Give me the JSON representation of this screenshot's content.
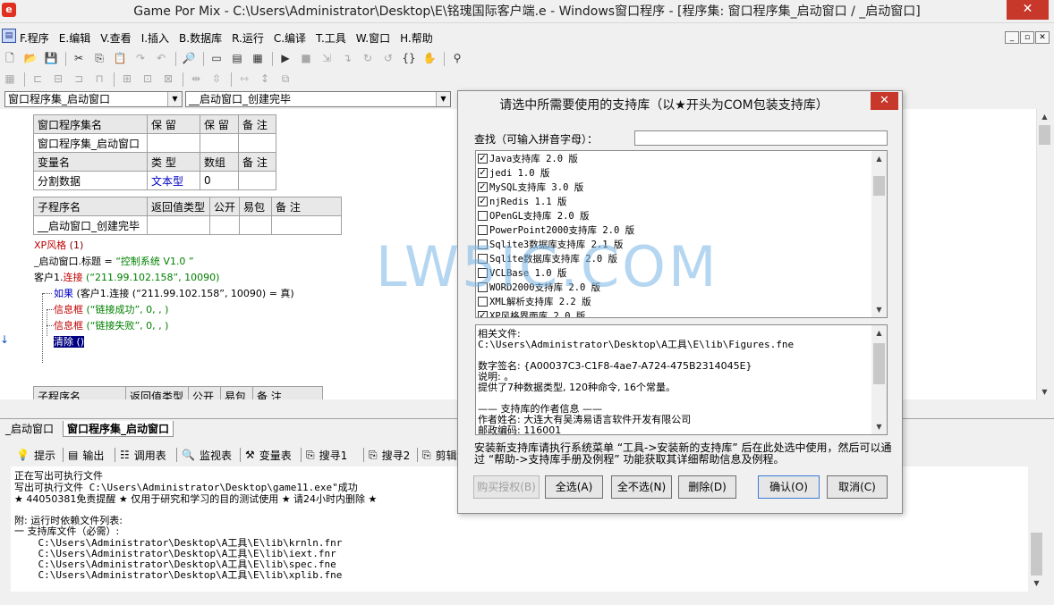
{
  "window": {
    "title": "Game Por Mix - C:\\Users\\Administrator\\Desktop\\E\\铭瑰国际客户端.e - Windows窗口程序 - [程序集: 窗口程序集_启动窗口 / _启动窗口]",
    "logo": "e",
    "close": "✕"
  },
  "menu": {
    "items": [
      "F.程序",
      "E.编辑",
      "V.查看",
      "I.插入",
      "B.数据库",
      "R.运行",
      "C.编译",
      "T.工具",
      "W.窗口",
      "H.帮助"
    ],
    "mdi": [
      "_",
      "▫",
      "✕"
    ]
  },
  "combos": {
    "left": "窗口程序集_启动窗口",
    "right": "__启动窗口_创建完毕"
  },
  "editor": {
    "table1": {
      "headers": [
        "窗口程序集名",
        "保 留",
        "保 留",
        "备 注"
      ],
      "row": [
        "窗口程序集_启动窗口",
        "",
        "",
        ""
      ],
      "var_headers": [
        "变量名",
        "类 型",
        "数组",
        "备 注"
      ],
      "var_row": [
        "分割数据",
        "文本型",
        "0",
        ""
      ]
    },
    "table2": {
      "headers": [
        "子程序名",
        "返回值类型",
        "公开",
        "易包",
        "备 注"
      ],
      "row": [
        "__启动窗口_创建完毕",
        "",
        "",
        "",
        ""
      ]
    },
    "table3": {
      "headers": [
        "子程序名",
        "返回值类型",
        "公开",
        "易包",
        "备 注"
      ]
    },
    "code": {
      "line1_fn": "XP风格",
      "line1_arg": " (1)",
      "line2_obj": "_启动窗口.",
      "line2_prop": "标题",
      "line2_eq": " = ",
      "line2_str": "“控制系统 V1.0  ”",
      "line3_obj": "客户1.",
      "line3_fn": "连接",
      "line3_args": " (“211.99.102.158”, 10090)",
      "line4_kw": "如果",
      "line4_args": " (客户1.连接 (“211.99.102.158”, 10090) = 真)",
      "line5_fn": "信息框",
      "line5_args": " (“链接成功”, 0, , )",
      "line6_fn": "信息框",
      "line6_args": " (“链接失败”, 0, , )",
      "line7": "清除 ()"
    }
  },
  "doc_tabs": [
    "_启动窗口",
    "窗口程序集_启动窗口"
  ],
  "bottom_tabs": [
    {
      "icon": "💡",
      "label": "提示"
    },
    {
      "icon": "▤",
      "label": "输出"
    },
    {
      "icon": "☷",
      "label": "调用表"
    },
    {
      "icon": "🔍",
      "label": "监视表"
    },
    {
      "icon": "⚒",
      "label": "变量表"
    },
    {
      "icon": "⎘",
      "label": "搜寻1"
    },
    {
      "icon": "⎘",
      "label": "搜寻2"
    },
    {
      "icon": "⎘",
      "label": "剪辑"
    }
  ],
  "output": {
    "lines": [
      "正在写出可执行文件",
      "写出可执行文件 C:\\Users\\Administrator\\Desktop\\game11.exe\"成功",
      "★ 44050381免责提醒 ★ 仅用于研究和学习的目的测试使用 ★ 请24小时内删除 ★",
      "",
      "附: 运行时依赖文件列表:",
      "一 支持库文件（必需）:",
      "    C:\\Users\\Administrator\\Desktop\\A工具\\E\\lib\\krnln.fnr",
      "    C:\\Users\\Administrator\\Desktop\\A工具\\E\\lib\\iext.fnr",
      "    C:\\Users\\Administrator\\Desktop\\A工具\\E\\lib\\spec.fne",
      "    C:\\Users\\Administrator\\Desktop\\A工具\\E\\lib\\xplib.fne"
    ]
  },
  "dialog": {
    "title": "请选中所需要使用的支持库（以★开头为COM包装支持库）",
    "close": "✕",
    "search_label": "查找（可输入拼音字母）：",
    "search_value": "",
    "libraries": [
      {
        "label": "Java支持库 2.0 版",
        "checked": true
      },
      {
        "label": "jedi 1.0 版",
        "checked": true
      },
      {
        "label": "MySQL支持库 3.0 版",
        "checked": true
      },
      {
        "label": "njRedis 1.1 版",
        "checked": true
      },
      {
        "label": "OPenGL支持库 2.0 版",
        "checked": false
      },
      {
        "label": "PowerPoint2000支持库 2.0 版",
        "checked": false
      },
      {
        "label": "Sqlite3数据库支持库 2.1 版",
        "checked": false
      },
      {
        "label": "Sqlite数据库支持库 2.0 版",
        "checked": false
      },
      {
        "label": "VCLBase 1.0 版",
        "checked": false
      },
      {
        "label": "WORD2000支持库 2.0 版",
        "checked": false
      },
      {
        "label": "XML解析支持库 2.2 版",
        "checked": false
      },
      {
        "label": "XP风格界面库 2.0 版",
        "checked": true
      }
    ],
    "info": {
      "lines": [
        "相关文件:",
        "C:\\Users\\Administrator\\Desktop\\A工具\\E\\lib\\Figures.fne",
        "",
        "数字签名: {A00037C3-C1F8-4ae7-A724-475B2314045E}",
        "说明: 。",
        "提供了7种数据类型, 120种命令, 16个常量。",
        "",
        "—— 支持库的作者信息 ——",
        "作者姓名: 大连大有吴涛易语言软件开发有限公司",
        "邮政编码: 116001"
      ]
    },
    "hint": "安装新支持库请执行系统菜单 “工具->安装新的支持库” 后在此处选中使用，然后可以通过 “帮助->支持库手册及例程” 功能获取其详细帮助信息及例程。",
    "buttons": {
      "buy": "购买授权(B)",
      "select_all": "全选(A)",
      "select_none": "全不选(N)",
      "delete": "删除(D)",
      "ok": "确认(O)",
      "cancel": "取消(C)"
    }
  },
  "watermark": "LW5IC.COM"
}
